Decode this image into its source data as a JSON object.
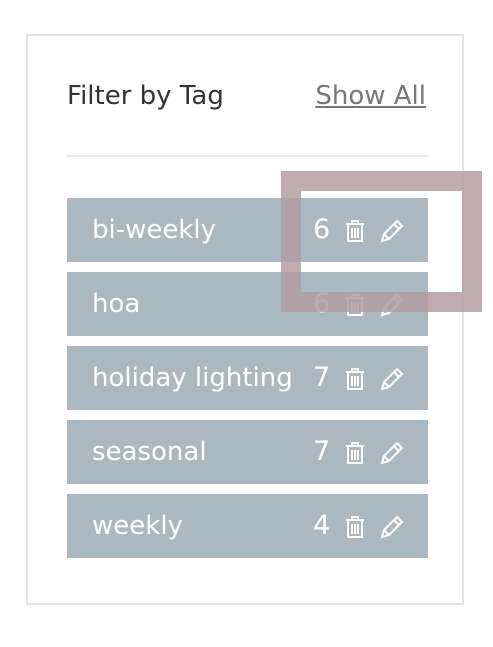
{
  "header": {
    "title": "Filter by Tag",
    "show_all_label": "Show All"
  },
  "tags": [
    {
      "name": "bi-weekly",
      "count": "6"
    },
    {
      "name": "hoa",
      "count": "6"
    },
    {
      "name": "holiday lighting",
      "count": "7"
    },
    {
      "name": "seasonal",
      "count": "7"
    },
    {
      "name": "weekly",
      "count": "4"
    }
  ],
  "icons": {
    "delete": "trash-icon",
    "edit": "pencil-icon"
  },
  "colors": {
    "tag_background": "#aab8c1",
    "tag_text": "#ffffff",
    "highlight": "#b49ea2",
    "link": "#777777"
  }
}
